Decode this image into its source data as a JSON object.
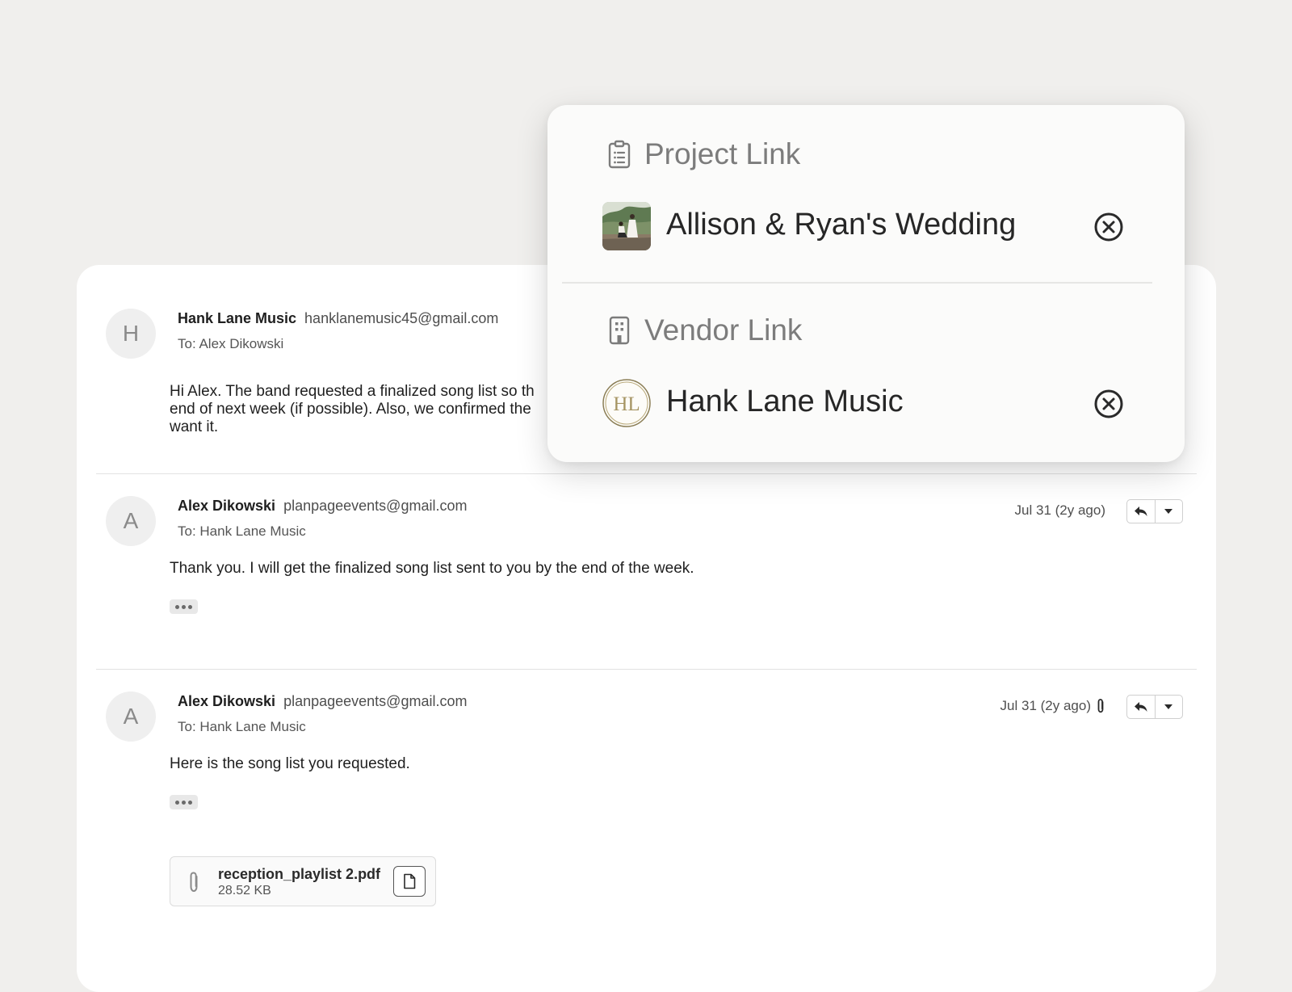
{
  "thread": {
    "messages": [
      {
        "avatar_initial": "H",
        "sender_name": "Hank Lane Music",
        "sender_email": "hanklanemusic45@gmail.com",
        "to": "To: Alex Dikowski",
        "body_lines": [
          "Hi Alex. The band requested a finalized song list so th",
          "end of next week (if possible). Also, we confirmed the",
          "want it."
        ]
      },
      {
        "avatar_initial": "A",
        "sender_name": "Alex Dikowski",
        "sender_email": "planpageevents@gmail.com",
        "to": "To: Hank Lane Music",
        "timestamp": "Jul 31 (2y ago)",
        "body": "Thank you. I will get the finalized song list sent to you by the end of the week."
      },
      {
        "avatar_initial": "A",
        "sender_name": "Alex Dikowski",
        "sender_email": "planpageevents@gmail.com",
        "to": "To: Hank Lane Music",
        "timestamp": "Jul 31 (2y ago)",
        "body": "Here is the song list you requested.",
        "attachment": {
          "filename": "reception_playlist 2.pdf",
          "size": "28.52 KB"
        }
      }
    ]
  },
  "popover": {
    "project_link": {
      "heading": "Project Link",
      "icon": "clipboard-list-icon",
      "item": "Allison & Ryan's Wedding"
    },
    "vendor_link": {
      "heading": "Vendor Link",
      "icon": "building-icon",
      "item": "Hank Lane Music",
      "logo_text": "HL"
    }
  },
  "colors": {
    "page_background": "#f0efed",
    "card_background": "#ffffff",
    "popover_background": "#fbfbfa",
    "muted_heading": "#7c7c7c",
    "avatar_background": "#efefef",
    "logo_gold": "#b8a878"
  }
}
